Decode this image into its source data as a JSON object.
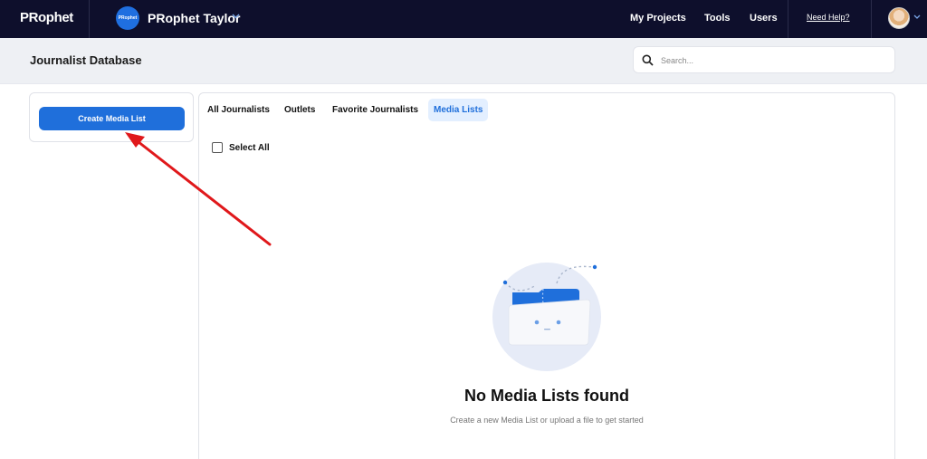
{
  "topbar": {
    "logo": "PRophet",
    "workspace": {
      "avatar_text": "PRophet",
      "name": "PRophet Taylor"
    },
    "nav": [
      "My Projects",
      "Tools",
      "Users"
    ],
    "help_link": "Need Help?"
  },
  "header": {
    "title": "Journalist Database",
    "search_placeholder": "Search..."
  },
  "sidebar": {
    "create_button": "Create Media List"
  },
  "tabs": [
    {
      "label": "All Journalists",
      "active": false
    },
    {
      "label": "Outlets",
      "active": false
    },
    {
      "label": "Favorite Journalists",
      "active": false
    },
    {
      "label": "Media Lists",
      "active": true
    }
  ],
  "list": {
    "select_all_label": "Select All"
  },
  "empty_state": {
    "title": "No Media Lists found",
    "subtitle": "Create a new Media List or upload a file to get started"
  },
  "colors": {
    "topbar_bg": "#0e0f2c",
    "accent": "#1f6fdb",
    "active_tab_bg": "#e3efff",
    "annotation_arrow": "#e0181b"
  }
}
